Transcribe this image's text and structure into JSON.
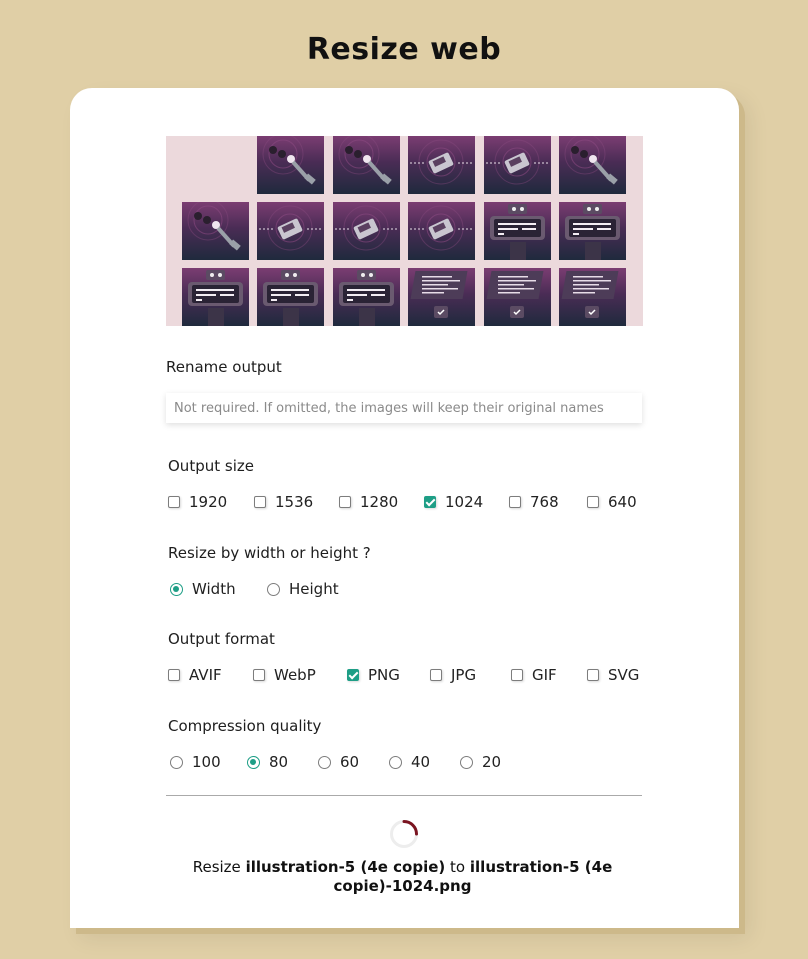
{
  "header": {
    "title": "Resize web"
  },
  "rename": {
    "label": "Rename output",
    "placeholder": "Not required. If omitted, the images will keep their original names",
    "value": ""
  },
  "output_size": {
    "label": "Output size",
    "options": [
      {
        "label": "1920",
        "checked": false
      },
      {
        "label": "1536",
        "checked": false
      },
      {
        "label": "1280",
        "checked": false
      },
      {
        "label": "1024",
        "checked": true
      },
      {
        "label": "768",
        "checked": false
      },
      {
        "label": "640",
        "checked": false
      }
    ]
  },
  "resize_by": {
    "label": "Resize by width or height ?",
    "options": [
      {
        "label": "Width",
        "selected": true
      },
      {
        "label": "Height",
        "selected": false
      }
    ]
  },
  "output_format": {
    "label": "Output format",
    "options": [
      {
        "label": "AVIF",
        "checked": false
      },
      {
        "label": "WebP",
        "checked": false
      },
      {
        "label": "PNG",
        "checked": true
      },
      {
        "label": "JPG",
        "checked": false
      },
      {
        "label": "GIF",
        "checked": false
      },
      {
        "label": "SVG",
        "checked": false
      }
    ]
  },
  "compression": {
    "label": "Compression quality",
    "options": [
      {
        "label": "100",
        "selected": false
      },
      {
        "label": "80",
        "selected": true
      },
      {
        "label": "60",
        "selected": false
      },
      {
        "label": "40",
        "selected": false
      },
      {
        "label": "20",
        "selected": false
      }
    ]
  },
  "status": {
    "prefix": "Resize",
    "source": "illustration-5 (4e copie)",
    "middle": "to",
    "target": "illustration-5 (4e copie)-1024.png"
  },
  "colors": {
    "background": "#e0cfa6",
    "accent": "#1e9e86",
    "spinner": "#7a1420",
    "thumb_area": "#ecd9dc"
  },
  "thumbnails": {
    "icons": [
      "traffic-light-icon",
      "traffic-light-icon",
      "device-icon",
      "device-icon",
      "traffic-light-icon",
      "traffic-light-icon",
      "device-icon",
      "device-icon",
      "device-icon",
      "robot-icon",
      "robot-icon",
      "robot-icon",
      "robot-icon",
      "robot-icon",
      "circuit-board-icon",
      "circuit-board-icon",
      "circuit-board-icon"
    ]
  }
}
